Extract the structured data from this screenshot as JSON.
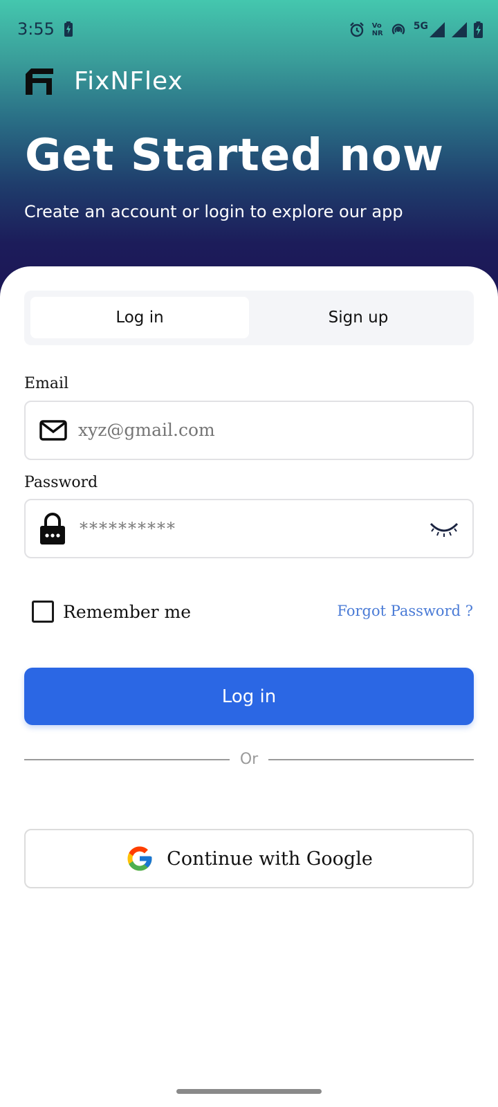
{
  "status_bar": {
    "time": "3:55",
    "volte_line1": "Vo",
    "volte_line2": "NR",
    "network": "5G",
    "icons": [
      "battery-saver-icon",
      "alarm-icon",
      "volte-icon",
      "hotspot-icon",
      "signal-icon",
      "signal-icon",
      "battery-icon"
    ]
  },
  "brand": {
    "name": "FixNFlex",
    "logo": "fixnflex-logo"
  },
  "hero": {
    "headline": "Get Started now",
    "subtitle": "Create an account or login to explore our app"
  },
  "tabs": {
    "login": "Log in",
    "signup": "Sign up",
    "active": "login"
  },
  "form": {
    "email_label": "Email",
    "email_placeholder": "xyz@gmail.com",
    "email_icon": "mail-icon",
    "password_label": "Password",
    "password_value": "**********",
    "password_icon": "lock-icon",
    "password_toggle_icon": "eye-closed-icon",
    "remember_label": "Remember me",
    "remember_checked": false,
    "forgot_label": "Forgot Password ?",
    "login_button": "Log in",
    "divider_text": "Or",
    "google_button": "Continue with Google",
    "google_icon": "google-icon"
  },
  "colors": {
    "primary": "#2b67e4",
    "link": "#4a7bd6",
    "gradient_top": "#44c7ae",
    "gradient_bottom": "#1b1656"
  }
}
